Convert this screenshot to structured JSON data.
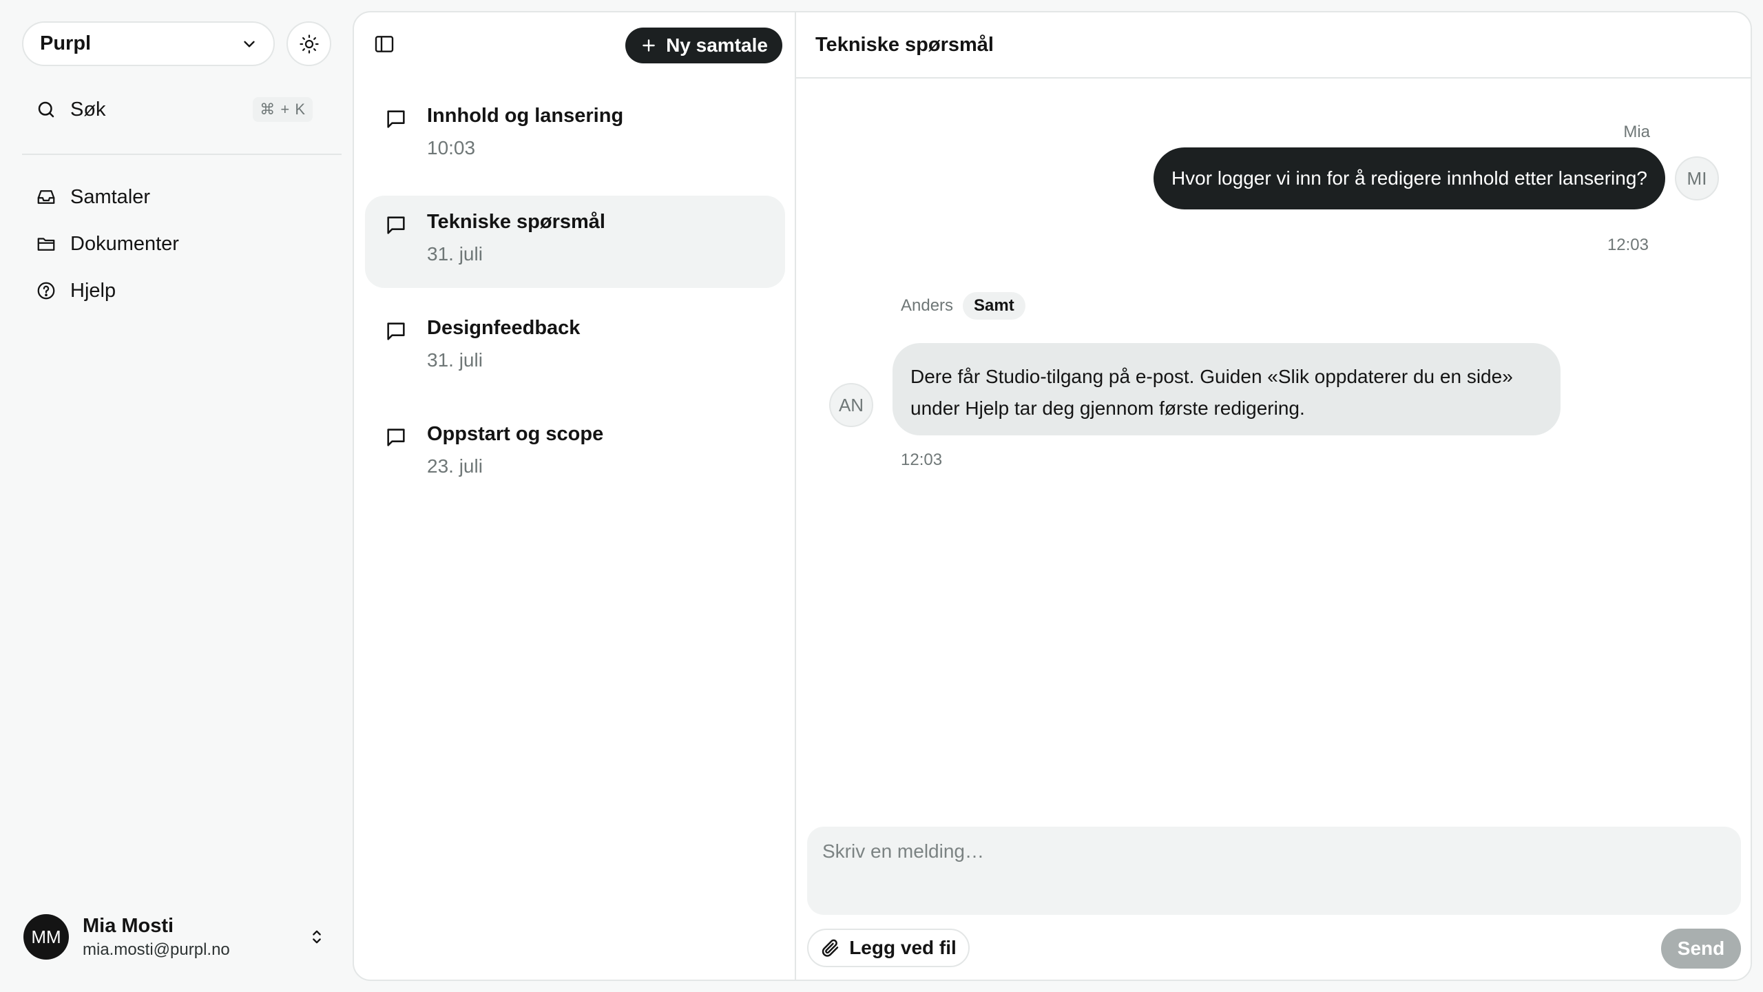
{
  "sidebar": {
    "workspace": "Purpl",
    "search": {
      "label": "Søk",
      "shortcut": "⌘ + K"
    },
    "nav": [
      {
        "label": "Samtaler",
        "icon": "inbox-icon"
      },
      {
        "label": "Dokumenter",
        "icon": "folder-icon"
      },
      {
        "label": "Hjelp",
        "icon": "help-circle-icon"
      }
    ],
    "user": {
      "initials": "MM",
      "name": "Mia Mosti",
      "email": "mia.mosti@purpl.no"
    }
  },
  "conversations": {
    "new_button": "Ny samtale",
    "items": [
      {
        "title": "Innhold og lansering",
        "date": "10:03",
        "active": false
      },
      {
        "title": "Tekniske spørsmål",
        "date": "31. juli",
        "active": true
      },
      {
        "title": "Designfeedback",
        "date": "31. juli",
        "active": false
      },
      {
        "title": "Oppstart og scope",
        "date": "23. juli",
        "active": false
      }
    ]
  },
  "chat": {
    "title": "Tekniske spørsmål",
    "messages": [
      {
        "sender": "Mia",
        "initials": "MI",
        "text": "Hvor logger vi inn for å redigere innhold etter lansering?",
        "time": "12:03"
      },
      {
        "sender": "Anders",
        "badge": "Samt",
        "initials": "AN",
        "lines": [
          "Dere får Studio-tilgang på e-post. Guiden «Slik oppdaterer du en side»",
          "under Hjelp tar deg gjennom første redigering."
        ],
        "time": "12:03"
      }
    ],
    "composer": {
      "placeholder": "Skriv en melding…",
      "attach_label": "Legg ved fil",
      "send_label": "Send"
    }
  },
  "colors": {
    "dark": "#1c2021",
    "active_bg": "#f1f3f3",
    "bubble_light": "#e7eaea",
    "send_disabled": "#a9afaf"
  }
}
